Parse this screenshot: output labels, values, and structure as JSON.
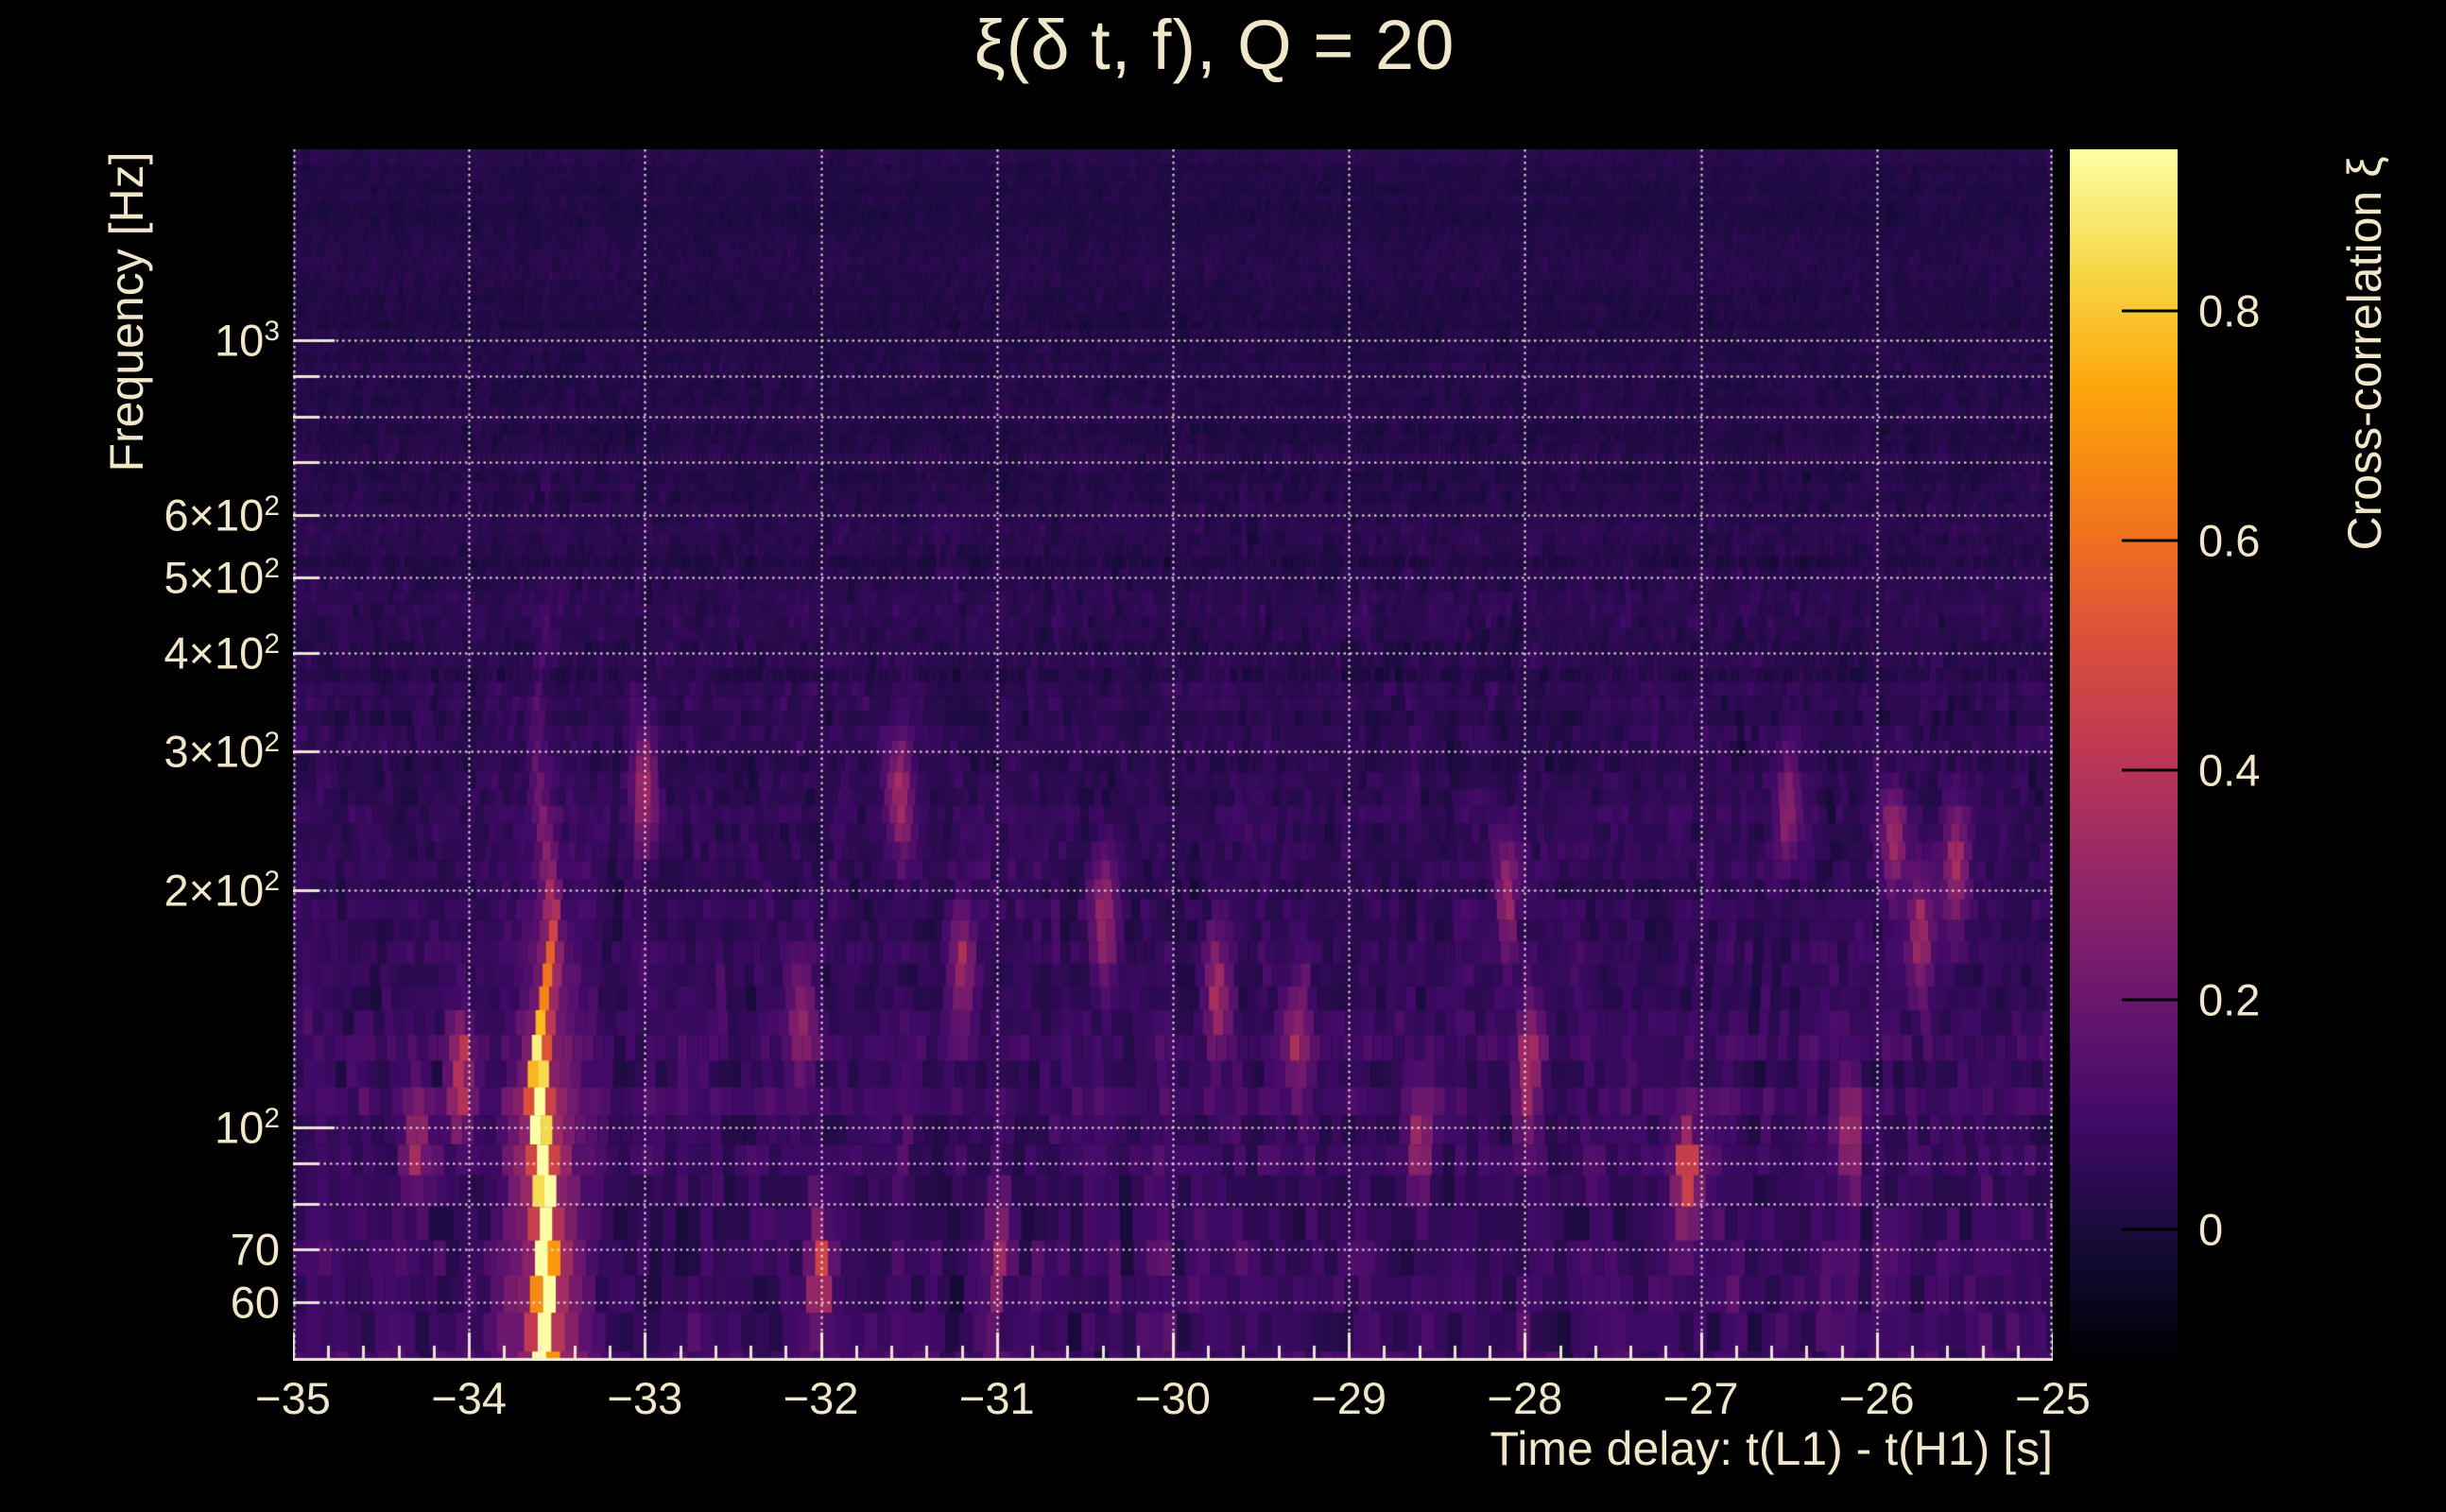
{
  "chart_data": {
    "type": "heatmap",
    "title": "ξ(δ t, f), Q = 20",
    "xlabel": "Time delay: t(L1) - t(H1) [s]",
    "ylabel": "Frequency [Hz]",
    "xlim": [
      -35,
      -25
    ],
    "ylim_hz": [
      50.5,
      1748
    ],
    "y_scale": "log",
    "grid": "dotted",
    "x_ticks": [
      {
        "t": -35,
        "label": "−35"
      },
      {
        "t": -34,
        "label": "−34"
      },
      {
        "t": -33,
        "label": "−33"
      },
      {
        "t": -32,
        "label": "−32"
      },
      {
        "t": -31,
        "label": "−31"
      },
      {
        "t": -30,
        "label": "−30"
      },
      {
        "t": -29,
        "label": "−29"
      },
      {
        "t": -28,
        "label": "−28"
      },
      {
        "t": -27,
        "label": "−27"
      },
      {
        "t": -26,
        "label": "−26"
      },
      {
        "t": -25,
        "label": "−25"
      }
    ],
    "x_minor_tick_step": 0.2,
    "y_ticks": [
      {
        "f": 1000,
        "base": "10",
        "exp": "3"
      },
      {
        "f": 600,
        "base": "6×10",
        "exp": "2"
      },
      {
        "f": 500,
        "base": "5×10",
        "exp": "2"
      },
      {
        "f": 400,
        "base": "4×10",
        "exp": "2"
      },
      {
        "f": 300,
        "base": "3×10",
        "exp": "2"
      },
      {
        "f": 200,
        "base": "2×10",
        "exp": "2"
      },
      {
        "f": 100,
        "base": "10",
        "exp": "2"
      },
      {
        "f": 70,
        "base": "70",
        "exp": ""
      },
      {
        "f": 60,
        "base": "60",
        "exp": ""
      }
    ],
    "y_grid_freqs": [
      1000,
      900,
      800,
      700,
      600,
      500,
      400,
      300,
      200,
      100,
      90,
      80,
      70,
      60
    ],
    "colorbar": {
      "label": "Cross-correlation ξ",
      "vmin": -0.114,
      "vmax": 0.941,
      "ticks": [
        {
          "v": 0.8,
          "label": "0.8"
        },
        {
          "v": 0.6,
          "label": "0.6"
        },
        {
          "v": 0.4,
          "label": "0.4"
        },
        {
          "v": 0.2,
          "label": "0.2"
        },
        {
          "v": 0.0,
          "label": "0"
        }
      ]
    },
    "colormap": {
      "name": "inferno",
      "stops": [
        [
          0.0,
          "#000004"
        ],
        [
          0.1,
          "#160b39"
        ],
        [
          0.2,
          "#420a68"
        ],
        [
          0.3,
          "#6a176e"
        ],
        [
          0.4,
          "#932667"
        ],
        [
          0.5,
          "#bc3754"
        ],
        [
          0.6,
          "#dd513a"
        ],
        [
          0.7,
          "#f37819"
        ],
        [
          0.8,
          "#fca50a"
        ],
        [
          0.9,
          "#f6d746"
        ],
        [
          1.0,
          "#fcffa4"
        ]
      ]
    },
    "noise": {
      "seed": 987654321,
      "mu_top": 0.025,
      "mu_bottom_add": 0.075,
      "sigma_top": 0.035,
      "sigma_bottom_add": 0.075
    },
    "features": {
      "chirp": {
        "t0": -33.57,
        "comment": "bright chirp streak: white-hot below ~110 Hz, orange fading to ~300 Hz",
        "peak_xi": 0.94,
        "core_sigma_t": 0.03,
        "halo_sigma_t": 0.13,
        "halo_amp": 0.32
      },
      "hotspots": [
        {
          "t": -34.05,
          "f": 115,
          "xi": 0.38
        },
        {
          "t": -34.3,
          "f": 95,
          "xi": 0.28
        },
        {
          "t": -32.0,
          "f": 66,
          "xi": 0.34
        },
        {
          "t": -32.1,
          "f": 135,
          "xi": 0.24
        },
        {
          "t": -31.55,
          "f": 265,
          "xi": 0.32
        },
        {
          "t": -31.2,
          "f": 160,
          "xi": 0.3
        },
        {
          "t": -31.0,
          "f": 70,
          "xi": 0.25
        },
        {
          "t": -30.4,
          "f": 185,
          "xi": 0.27
        },
        {
          "t": -29.75,
          "f": 150,
          "xi": 0.29
        },
        {
          "t": -29.3,
          "f": 130,
          "xi": 0.26
        },
        {
          "t": -28.6,
          "f": 95,
          "xi": 0.25
        },
        {
          "t": -28.1,
          "f": 200,
          "xi": 0.25
        },
        {
          "t": -27.98,
          "f": 118,
          "xi": 0.26
        },
        {
          "t": -27.08,
          "f": 87,
          "xi": 0.46
        },
        {
          "t": -26.5,
          "f": 255,
          "xi": 0.25
        },
        {
          "t": -26.15,
          "f": 95,
          "xi": 0.3
        },
        {
          "t": -25.9,
          "f": 230,
          "xi": 0.26
        },
        {
          "t": -25.75,
          "f": 177,
          "xi": 0.28
        },
        {
          "t": -25.55,
          "f": 215,
          "xi": 0.3
        },
        {
          "t": -33.0,
          "f": 270,
          "xi": 0.29
        }
      ]
    }
  },
  "style": {
    "text_color": "#f0e7ca",
    "grid_color": "rgba(244,237,218,0.95)",
    "background": "#000000"
  }
}
